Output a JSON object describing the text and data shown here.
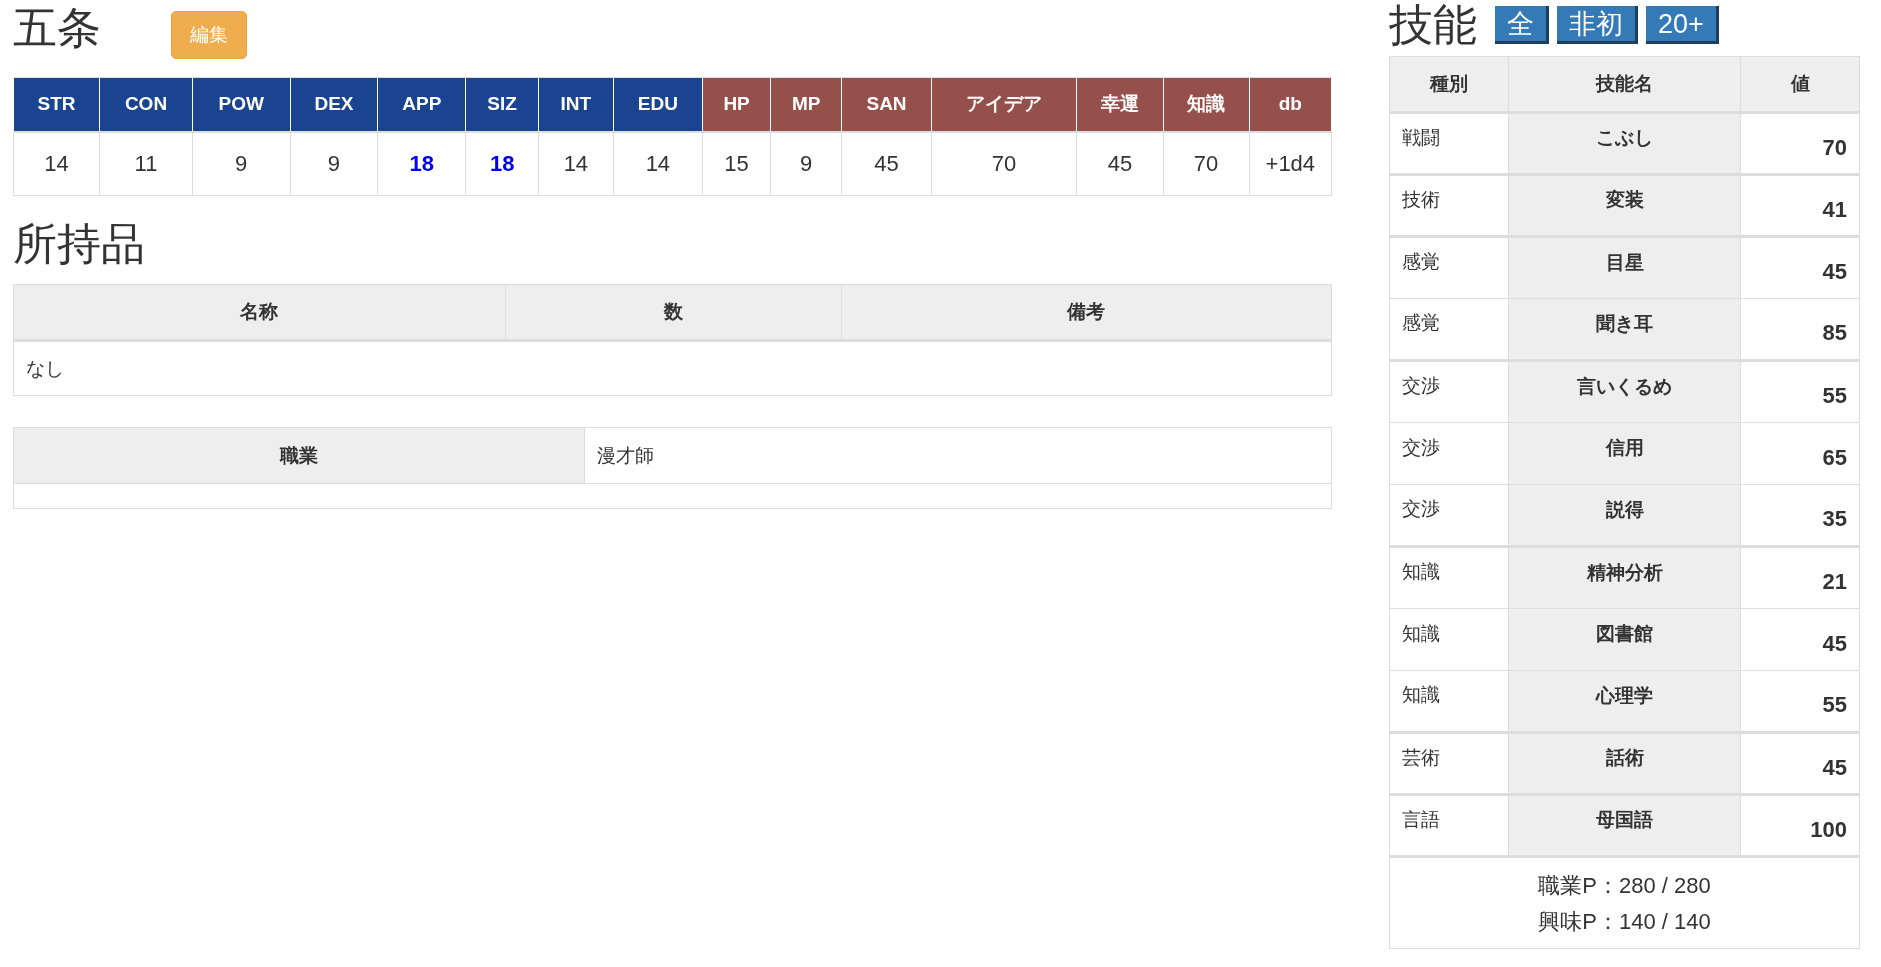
{
  "character": {
    "name": "五条",
    "edit_button": "編集"
  },
  "stats": [
    {
      "label": "STR",
      "value": "14",
      "kind": "base",
      "highlighted": false
    },
    {
      "label": "CON",
      "value": "11",
      "kind": "base",
      "highlighted": false
    },
    {
      "label": "POW",
      "value": "9",
      "kind": "base",
      "highlighted": false
    },
    {
      "label": "DEX",
      "value": "9",
      "kind": "base",
      "highlighted": false
    },
    {
      "label": "APP",
      "value": "18",
      "kind": "base",
      "highlighted": true
    },
    {
      "label": "SIZ",
      "value": "18",
      "kind": "base",
      "highlighted": true
    },
    {
      "label": "INT",
      "value": "14",
      "kind": "base",
      "highlighted": false
    },
    {
      "label": "EDU",
      "value": "14",
      "kind": "base",
      "highlighted": false
    },
    {
      "label": "HP",
      "value": "15",
      "kind": "derived",
      "highlighted": false
    },
    {
      "label": "MP",
      "value": "9",
      "kind": "derived",
      "highlighted": false
    },
    {
      "label": "SAN",
      "value": "45",
      "kind": "derived",
      "highlighted": false
    },
    {
      "label": "アイデア",
      "value": "70",
      "kind": "derived",
      "highlighted": false
    },
    {
      "label": "幸運",
      "value": "45",
      "kind": "derived",
      "highlighted": false
    },
    {
      "label": "知識",
      "value": "70",
      "kind": "derived",
      "highlighted": false
    },
    {
      "label": "db",
      "value": "+1d4",
      "kind": "derived",
      "highlighted": false
    }
  ],
  "inventory": {
    "title": "所持品",
    "columns": [
      "名称",
      "数",
      "備考"
    ],
    "empty_text": "なし"
  },
  "occupation": {
    "label": "職業",
    "value": "漫才師"
  },
  "skills": {
    "title": "技能",
    "filters": [
      "全",
      "非初",
      "20+"
    ],
    "columns": [
      "種別",
      "技能名",
      "値"
    ],
    "groups": [
      {
        "rows": [
          {
            "category": "戦闘",
            "name": "こぶし",
            "value": "70"
          }
        ]
      },
      {
        "rows": [
          {
            "category": "技術",
            "name": "変装",
            "value": "41"
          }
        ]
      },
      {
        "rows": [
          {
            "category": "感覚",
            "name": "目星",
            "value": "45"
          },
          {
            "category": "感覚",
            "name": "聞き耳",
            "value": "85"
          }
        ]
      },
      {
        "rows": [
          {
            "category": "交渉",
            "name": "言いくるめ",
            "value": "55"
          },
          {
            "category": "交渉",
            "name": "信用",
            "value": "65"
          },
          {
            "category": "交渉",
            "name": "説得",
            "value": "35"
          }
        ]
      },
      {
        "rows": [
          {
            "category": "知識",
            "name": "精神分析",
            "value": "21"
          },
          {
            "category": "知識",
            "name": "図書館",
            "value": "45"
          },
          {
            "category": "知識",
            "name": "心理学",
            "value": "55"
          }
        ]
      },
      {
        "rows": [
          {
            "category": "芸術",
            "name": "話術",
            "value": "45"
          }
        ]
      },
      {
        "rows": [
          {
            "category": "言語",
            "name": "母国語",
            "value": "100"
          }
        ]
      }
    ],
    "points": [
      "職業P：280 / 280",
      "興味P：140 / 140"
    ]
  }
}
